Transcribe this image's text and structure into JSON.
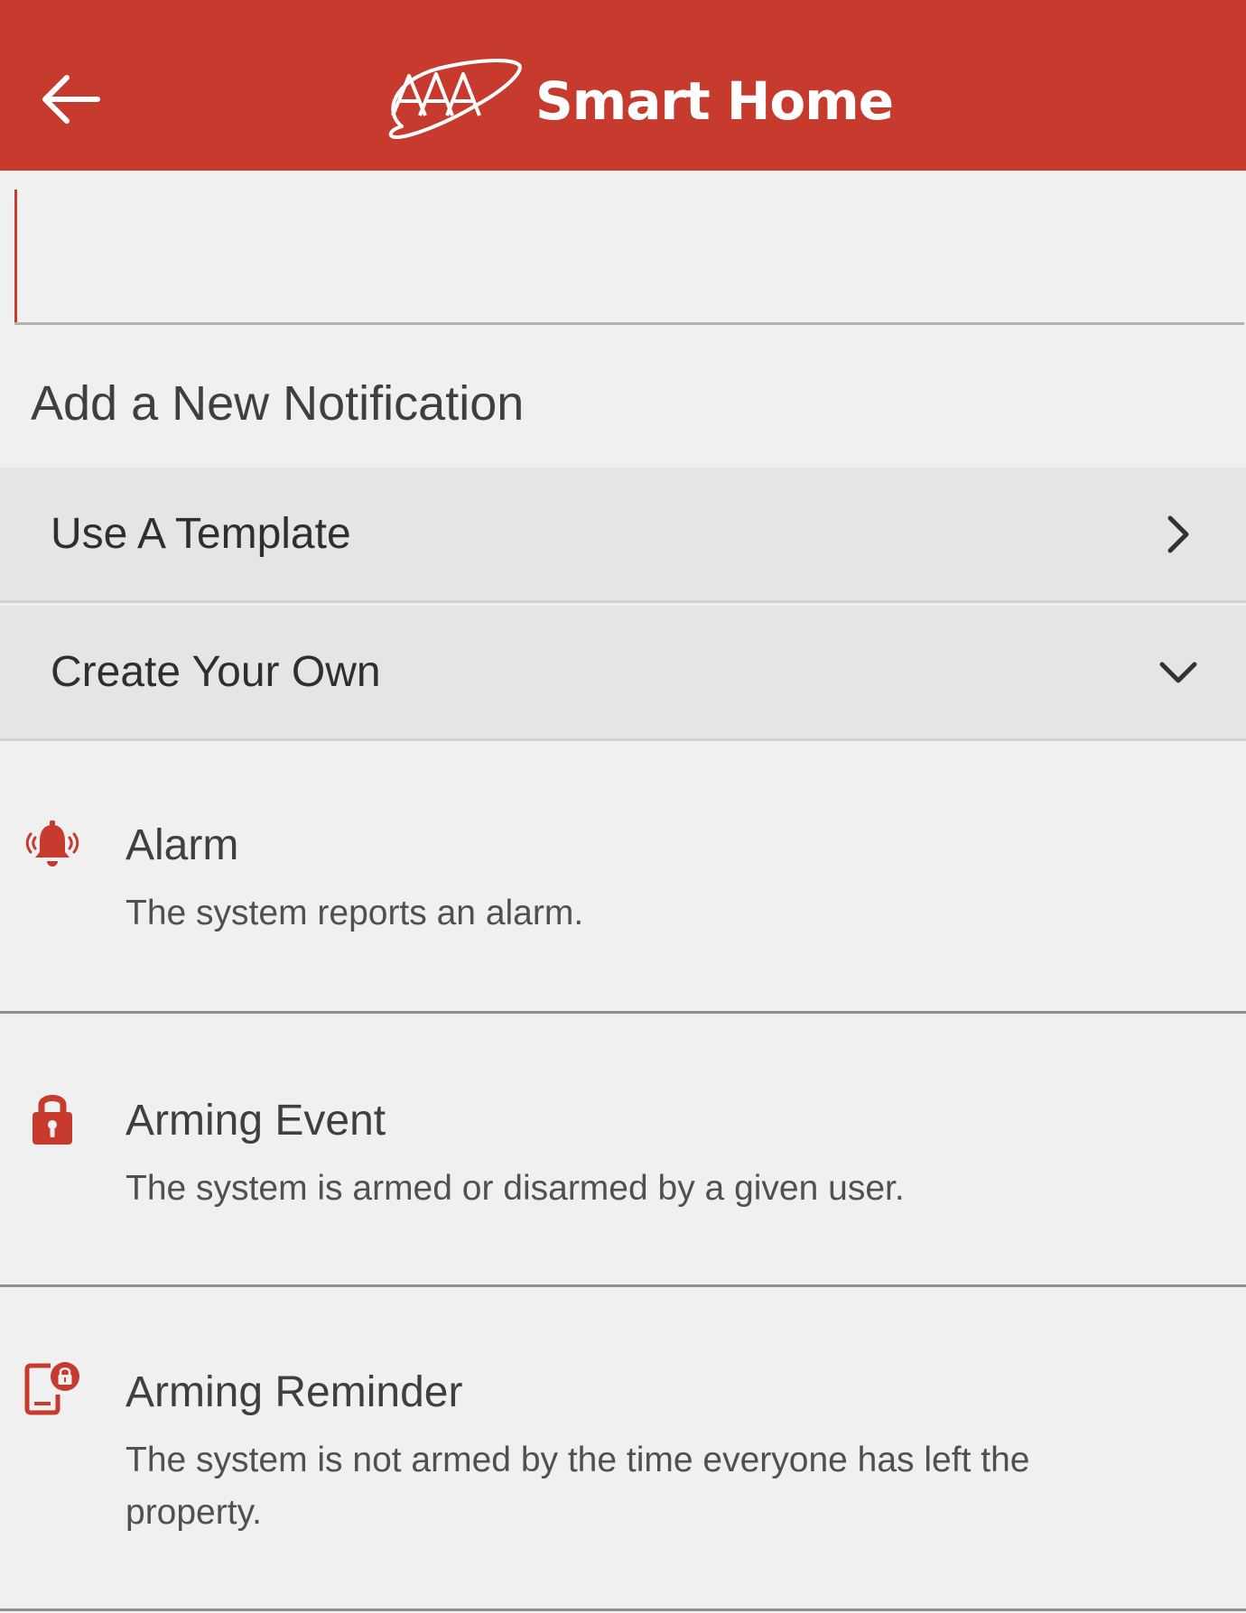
{
  "header": {
    "back_icon": "arrow-left-icon",
    "logo_icon": "aaa-logo-icon",
    "title": "Smart Home",
    "bg_color": "#c63b2d"
  },
  "name_input": {
    "value": "",
    "placeholder": ""
  },
  "section": {
    "title": "Add a New Notification"
  },
  "options": [
    {
      "label": "Use A Template",
      "icon": "chevron-right-icon"
    },
    {
      "label": "Create Your Own",
      "icon": "chevron-down-icon"
    }
  ],
  "notifications": [
    {
      "title": "Alarm",
      "description": "The system reports an alarm.",
      "icon": "alarm-bell-icon"
    },
    {
      "title": "Arming Event",
      "description": "The system is armed or disarmed by a given user.",
      "icon": "lock-icon"
    },
    {
      "title": "Arming Reminder",
      "description": "The system is not armed by the time everyone has left the property.",
      "icon": "phone-lock-icon"
    }
  ],
  "colors": {
    "accent": "#c63b2d",
    "background": "#f0f0f0",
    "row_background": "#e5e5e5"
  }
}
